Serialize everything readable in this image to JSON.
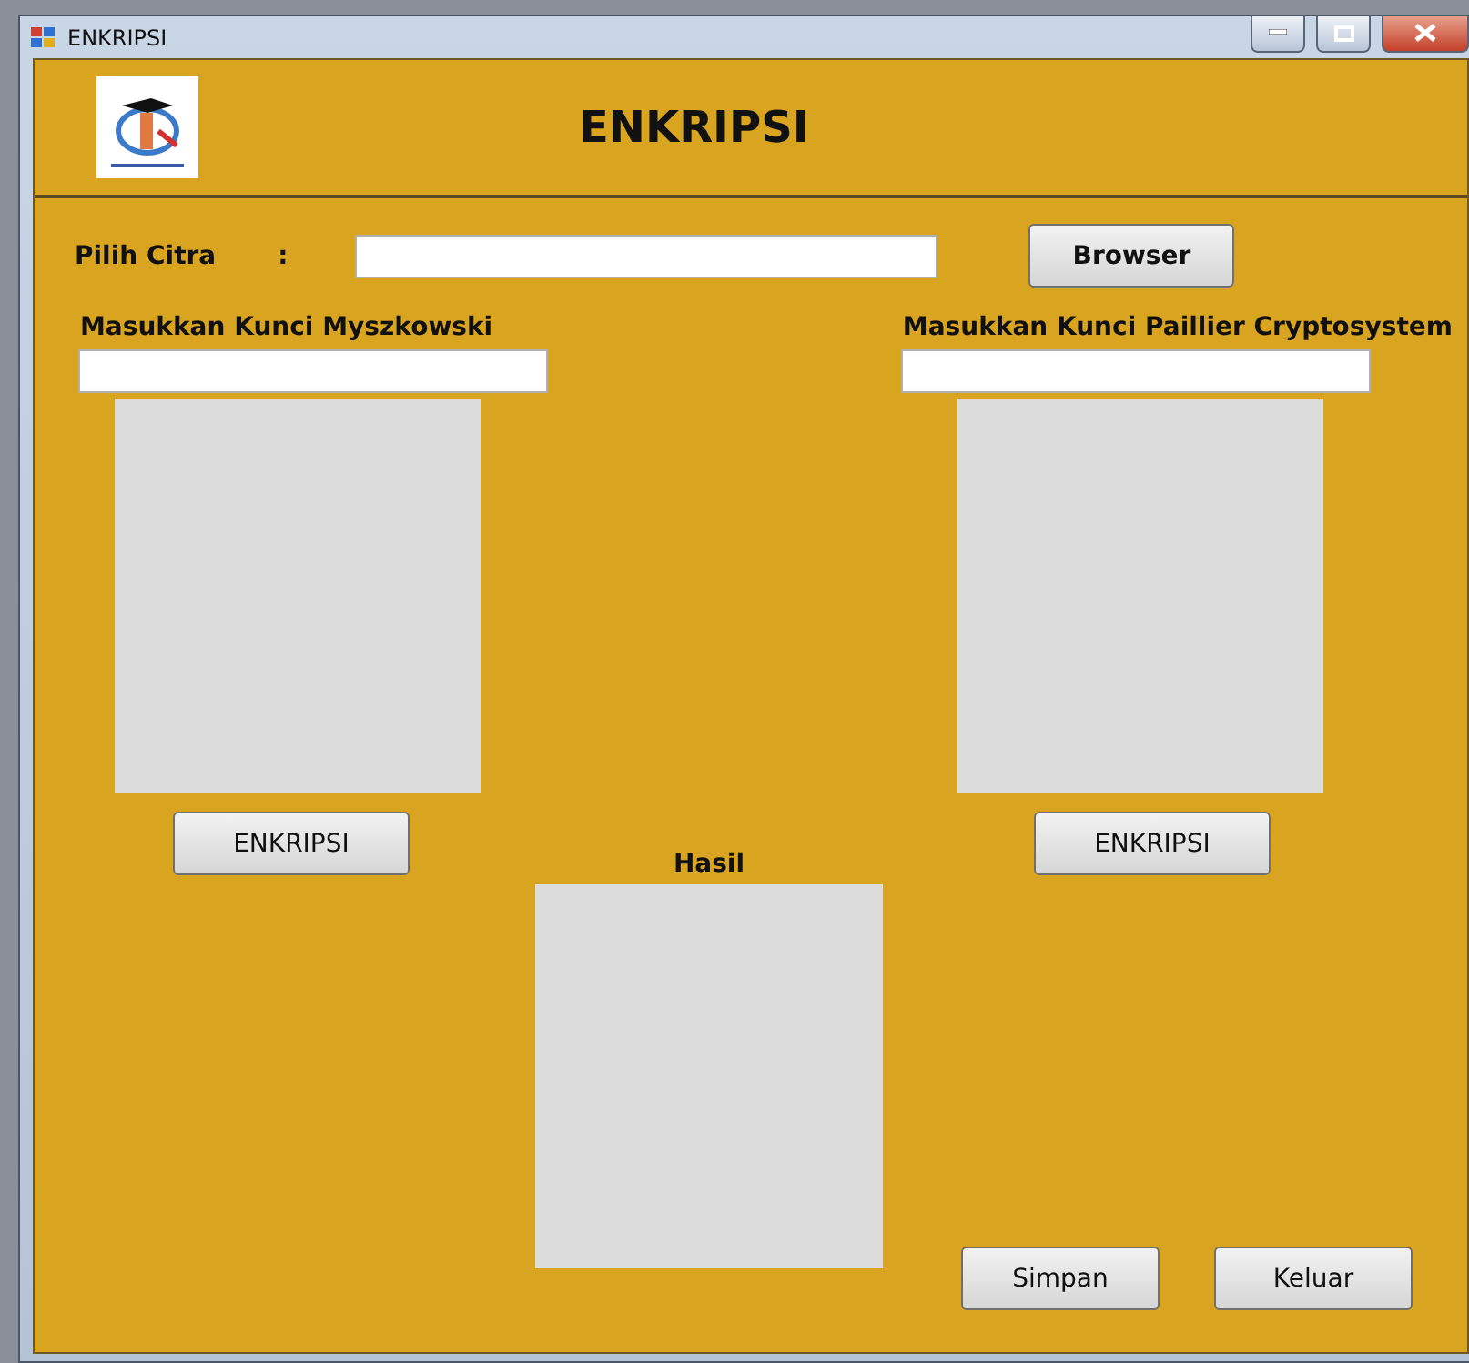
{
  "window": {
    "title": "ENKRIPSI"
  },
  "header": {
    "title": "ENKRIPSI"
  },
  "image_picker": {
    "label": "Pilih Citra",
    "separator": ":",
    "button": "Browser"
  },
  "keys": [
    {
      "label": "Masukkan Kunci Myszkowski",
      "button": "ENKRIPSI"
    },
    {
      "label": "Masukkan Kunci Paillier Cryptosystem",
      "button": "ENKRIPSI"
    }
  ],
  "result": {
    "label": "Hasil"
  },
  "buttons": [
    "Simpan",
    "Keluar"
  ]
}
